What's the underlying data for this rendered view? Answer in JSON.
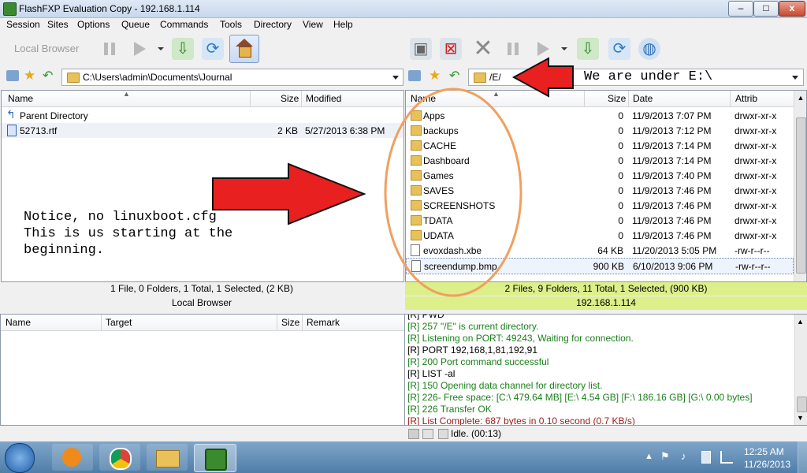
{
  "window": {
    "title": "FlashFXP Evaluation Copy - 192.168.1.114",
    "minimize": "–",
    "maximize": "□",
    "close": "x"
  },
  "menu": [
    "Session",
    "Sites",
    "Options",
    "Queue",
    "Commands",
    "Tools",
    "Directory",
    "View",
    "Help"
  ],
  "toolbar_left": {
    "label": "Local Browser"
  },
  "left_path": "C:\\Users\\admin\\Documents\\Journal",
  "right_path": "/E/",
  "left_columns": {
    "name": "Name",
    "size": "Size",
    "modified": "Modified"
  },
  "left_files": [
    {
      "name": "Parent Directory",
      "size": "",
      "modified": ""
    },
    {
      "name": "52713.rtf",
      "size": "2 KB",
      "modified": "5/27/2013 6:38 PM"
    }
  ],
  "right_columns": {
    "name": "Name",
    "size": "Size",
    "date": "Date",
    "attrib": "Attrib"
  },
  "right_files": [
    {
      "name": "Apps",
      "size": "0",
      "date": "11/9/2013 7:07 PM",
      "attrib": "drwxr-xr-x",
      "type": "folder"
    },
    {
      "name": "backups",
      "size": "0",
      "date": "11/9/2013 7:12 PM",
      "attrib": "drwxr-xr-x",
      "type": "folder"
    },
    {
      "name": "CACHE",
      "size": "0",
      "date": "11/9/2013 7:14 PM",
      "attrib": "drwxr-xr-x",
      "type": "folder"
    },
    {
      "name": "Dashboard",
      "size": "0",
      "date": "11/9/2013 7:14 PM",
      "attrib": "drwxr-xr-x",
      "type": "folder"
    },
    {
      "name": "Games",
      "size": "0",
      "date": "11/9/2013 7:40 PM",
      "attrib": "drwxr-xr-x",
      "type": "folder"
    },
    {
      "name": "SAVES",
      "size": "0",
      "date": "11/9/2013 7:46 PM",
      "attrib": "drwxr-xr-x",
      "type": "folder"
    },
    {
      "name": "SCREENSHOTS",
      "size": "0",
      "date": "11/9/2013 7:46 PM",
      "attrib": "drwxr-xr-x",
      "type": "folder"
    },
    {
      "name": "TDATA",
      "size": "0",
      "date": "11/9/2013 7:46 PM",
      "attrib": "drwxr-xr-x",
      "type": "folder"
    },
    {
      "name": "UDATA",
      "size": "0",
      "date": "11/9/2013 7:46 PM",
      "attrib": "drwxr-xr-x",
      "type": "folder"
    },
    {
      "name": "evoxdash.xbe",
      "size": "64 KB",
      "date": "11/20/2013 5:05 PM",
      "attrib": "-rw-r--r--",
      "type": "file"
    },
    {
      "name": "screendump.bmp",
      "size": "900 KB",
      "date": "6/10/2013 9:06 PM",
      "attrib": "-rw-r--r--",
      "type": "file"
    }
  ],
  "left_status": "1 File, 0 Folders, 1 Total, 1 Selected, (2 KB)",
  "left_status2": "Local Browser",
  "right_status": "2 Files, 9 Folders, 11 Total, 1 Selected, (900 KB)",
  "right_status2": "192.168.1.114",
  "queue_columns": {
    "name": "Name",
    "target": "Target",
    "size": "Size",
    "remark": "Remark"
  },
  "log_lines": [
    {
      "text": "[R] PWD",
      "color": "#000000"
    },
    {
      "text": "[R] 257 \"/E\" is current directory.",
      "color": "#1a7f1a"
    },
    {
      "text": "[R] Listening on PORT: 49243, Waiting for connection.",
      "color": "#1a7f1a"
    },
    {
      "text": "[R] PORT 192,168,1,81,192,91",
      "color": "#000000"
    },
    {
      "text": "[R] 200 Port command successful",
      "color": "#1a7f1a"
    },
    {
      "text": "[R] LIST -al",
      "color": "#000000"
    },
    {
      "text": "[R] 150 Opening data channel for directory list.",
      "color": "#1a7f1a"
    },
    {
      "text": "[R] 226- Free space: [C:\\ 479.64 MB] [E:\\ 4.54 GB] [F:\\ 186.16 GB] [G:\\ 0.00 bytes]",
      "color": "#1a7f1a"
    },
    {
      "text": "[R] 226 Transfer OK",
      "color": "#1a7f1a"
    },
    {
      "text": "[R] List Complete: 687 bytes in 0.10 second (0.7 KB/s)",
      "color": "#9a1a1a"
    }
  ],
  "idle_status": "Idle. (00:13)",
  "annotations": {
    "right_note": "We are under E:\\",
    "left_note_1": "Notice, no linuxboot.cfg",
    "left_note_2": "This is us starting at the",
    "left_note_3": "beginning."
  },
  "clock": {
    "time": "12:25 AM",
    "date": "11/26/2013"
  },
  "colors": {
    "status_connected": "#dcef8a",
    "arrow": "#e8201f",
    "circle": "#f0a060"
  }
}
